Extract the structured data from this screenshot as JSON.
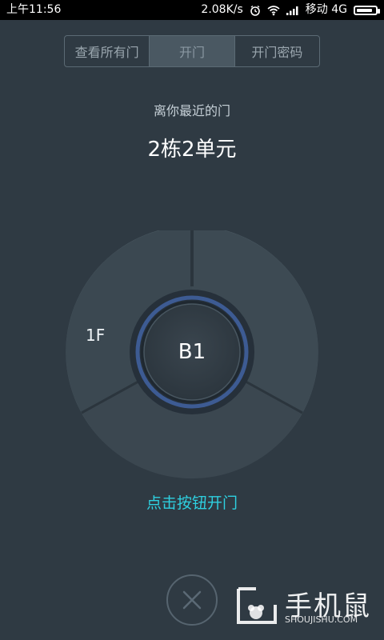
{
  "status_bar": {
    "time": "上午11:56",
    "speed": "2.08K/s",
    "carrier": "移动 4G",
    "battery_level": 0.85
  },
  "tabs": [
    {
      "label": "查看所有门",
      "active": false
    },
    {
      "label": "开门",
      "active": true
    },
    {
      "label": "开门密码",
      "active": false
    }
  ],
  "header": {
    "nearest_label": "离你最近的门",
    "building": "2栋2单元"
  },
  "dial": {
    "left_segment_label": "1F",
    "center_label": "B1"
  },
  "hint": "点击按钮开门",
  "watermark": {
    "brand_cn": "手机鼠",
    "brand_en": "SHOUJISHU.COM"
  },
  "colors": {
    "background": "#2f3a43",
    "accent": "#2ed0e0",
    "ring_blue": "#3d5b93"
  }
}
